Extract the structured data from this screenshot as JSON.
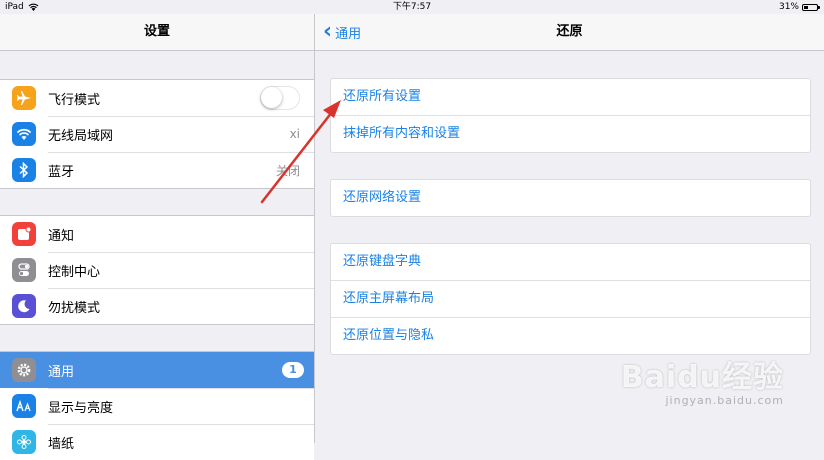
{
  "status_bar": {
    "device": "iPad",
    "time": "下午7:57",
    "battery_percent": "31%",
    "battery_level": 0.31
  },
  "left_panel": {
    "title": "设置",
    "groups": [
      [
        {
          "label": "飞行模式",
          "icon": "airplane-icon",
          "icon_color": "#f7a21b",
          "accessory": "toggle",
          "toggle_on": false
        },
        {
          "label": "无线局域网",
          "icon": "wifi-icon",
          "icon_color": "#1a82e6",
          "value": "xi"
        },
        {
          "label": "蓝牙",
          "icon": "bluetooth-icon",
          "icon_color": "#1a82e6",
          "value": "关闭"
        }
      ],
      [
        {
          "label": "通知",
          "icon": "notifications-icon",
          "icon_color": "#f2403a"
        },
        {
          "label": "控制中心",
          "icon": "control-center-icon",
          "icon_color": "#8e8e93"
        },
        {
          "label": "勿扰模式",
          "icon": "moon-icon",
          "icon_color": "#5a50d6"
        }
      ],
      [
        {
          "label": "通用",
          "icon": "gear-icon",
          "icon_color": "#8e8e93",
          "badge": "1",
          "selected": true
        },
        {
          "label": "显示与亮度",
          "icon": "display-brightness-icon",
          "icon_color": "#1a82e6"
        },
        {
          "label": "墙纸",
          "icon": "wallpaper-icon",
          "icon_color": "#2fb5e6"
        }
      ]
    ]
  },
  "right_panel": {
    "back_label": "通用",
    "title": "还原",
    "groups": [
      [
        "还原所有设置",
        "抹掉所有内容和设置"
      ],
      [
        "还原网络设置"
      ],
      [
        "还原键盘字典",
        "还原主屏幕布局",
        "还原位置与隐私"
      ]
    ]
  },
  "annotation": {
    "arrow_color": "#d9342b"
  },
  "watermark": {
    "main": "Baidu经验",
    "sub": "jingyan.baidu.com"
  },
  "colors": {
    "accent": "#1a82e6",
    "selected_row": "#4a90e2"
  }
}
